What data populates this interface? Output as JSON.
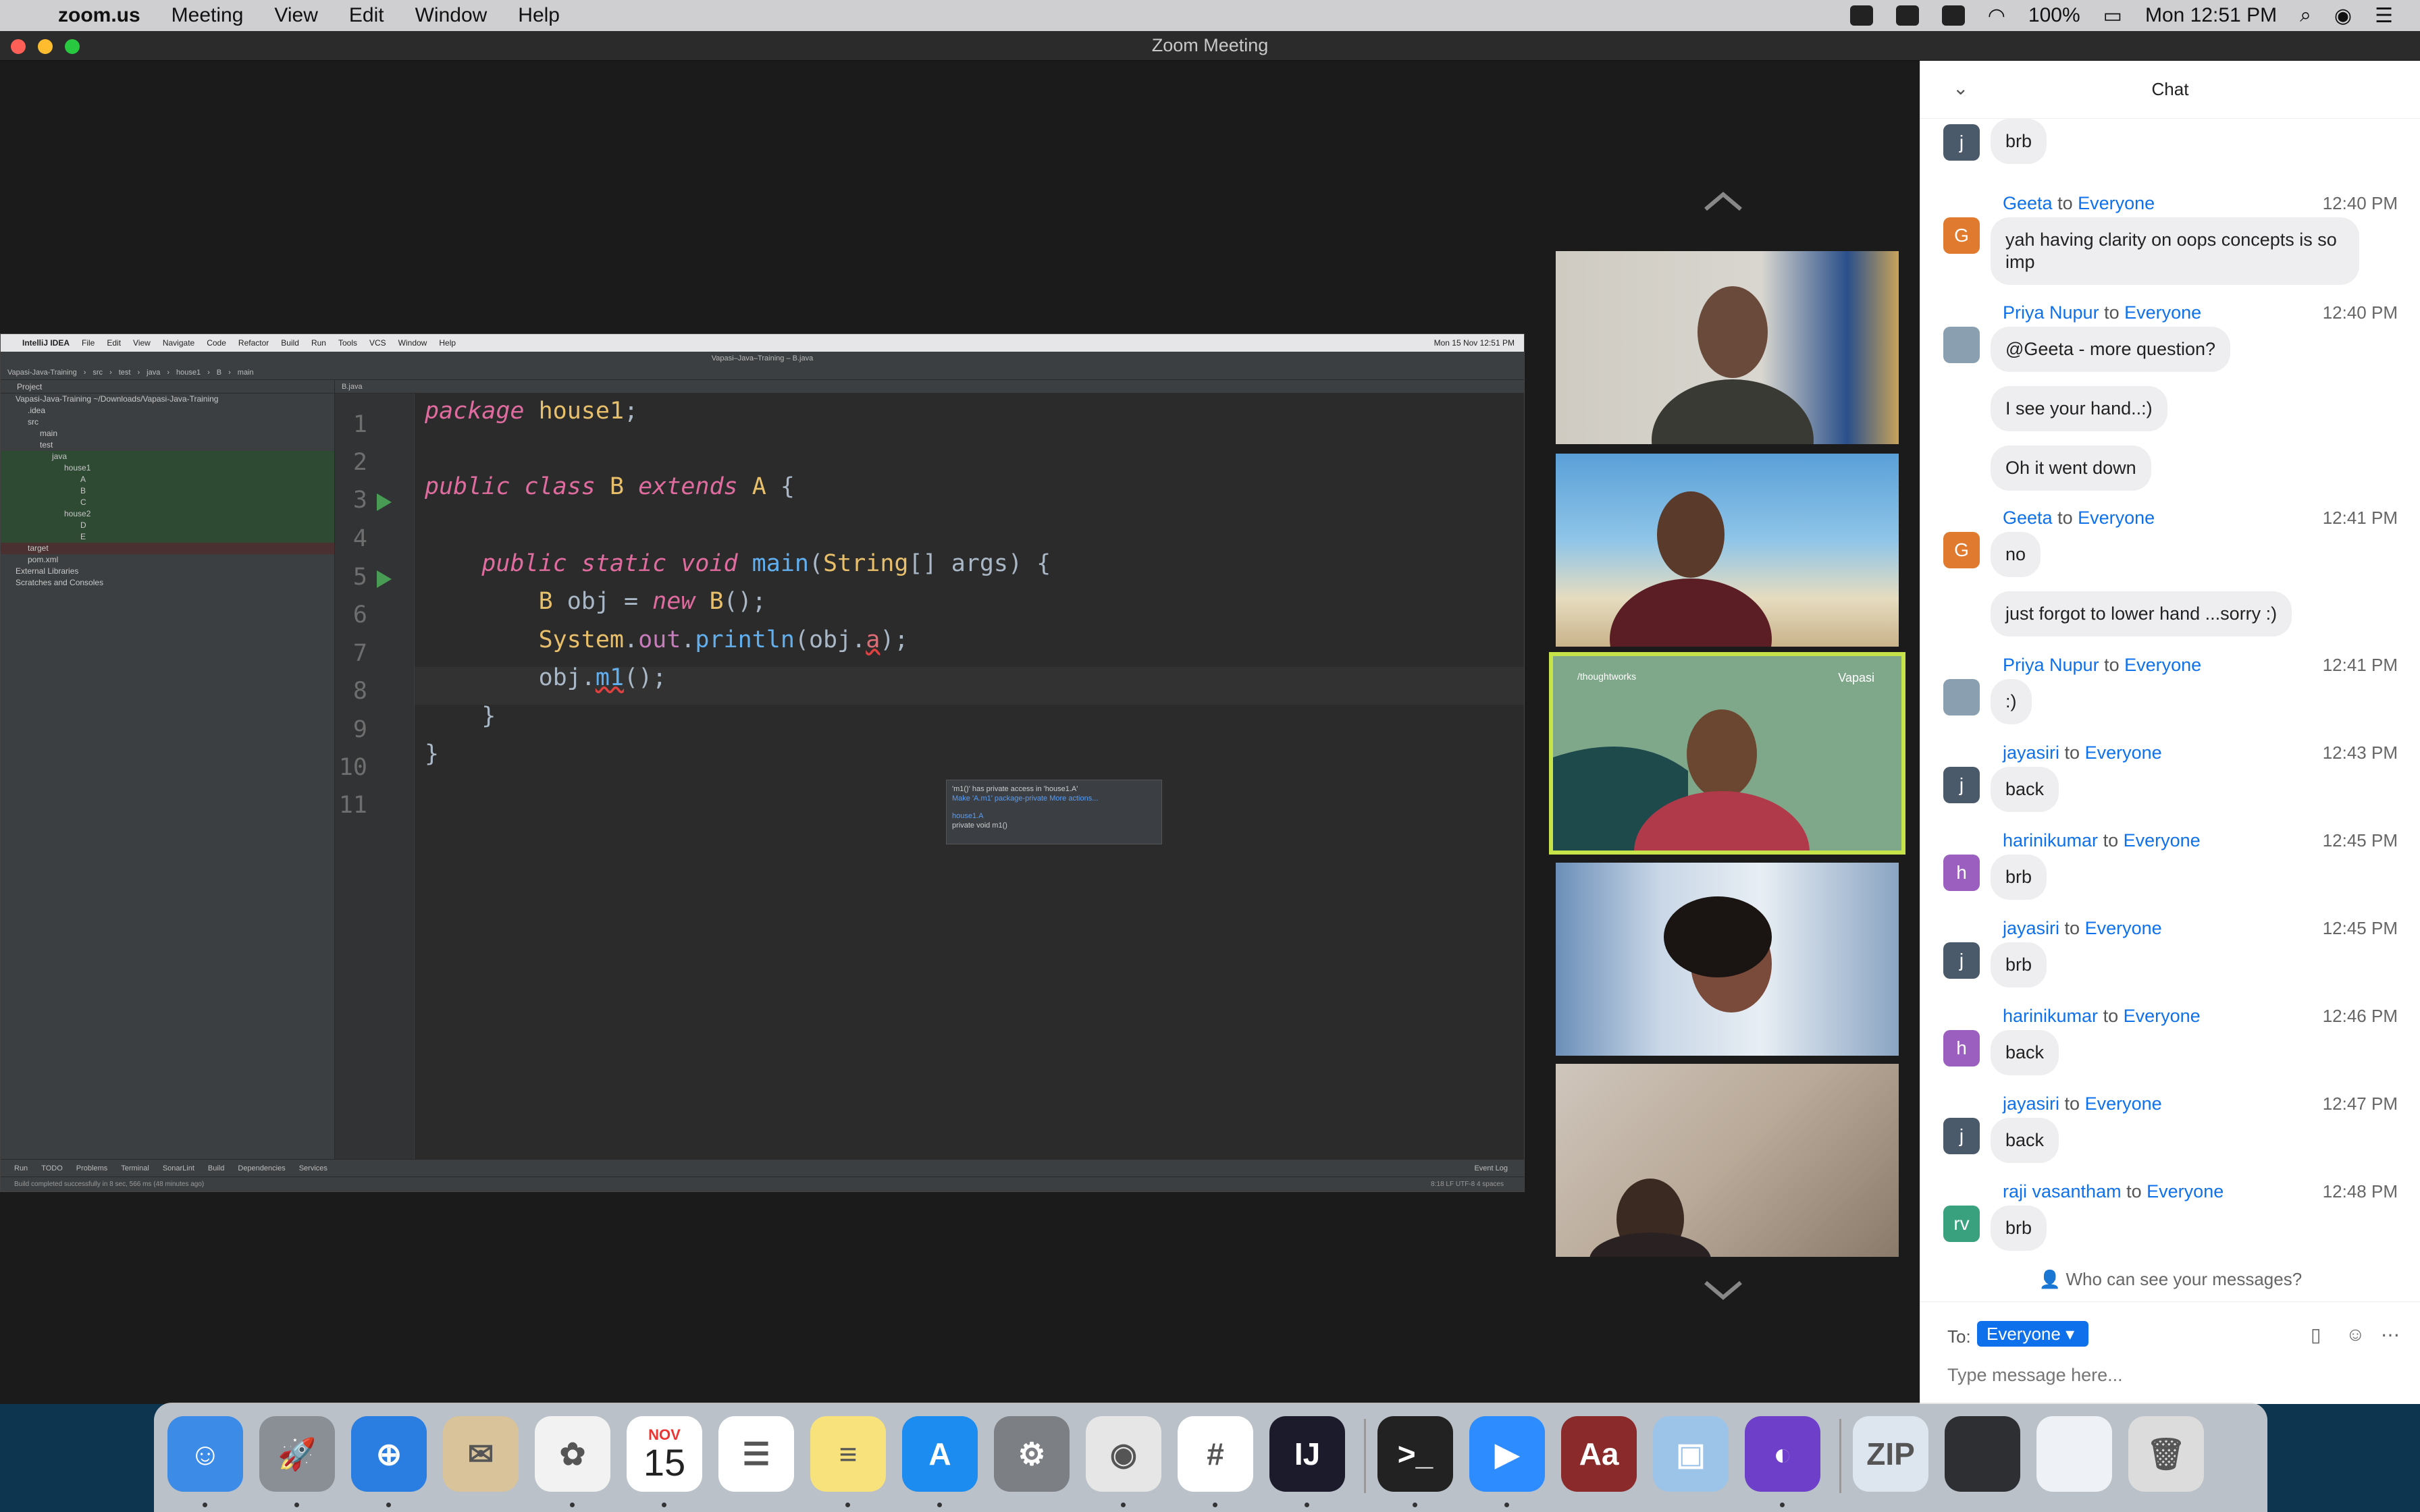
{
  "menubar": {
    "app": "zoom.us",
    "items": [
      "Meeting",
      "View",
      "Edit",
      "Window",
      "Help"
    ],
    "battery": "100%",
    "clock": "Mon 12:51 PM"
  },
  "window": {
    "title": "Zoom Meeting"
  },
  "shared_screen": {
    "ide_menu": [
      "IntelliJ IDEA",
      "File",
      "Edit",
      "View",
      "Navigate",
      "Code",
      "Refactor",
      "Build",
      "Run",
      "Tools",
      "VCS",
      "Window",
      "Help"
    ],
    "ide_clock": "Mon 15 Nov 12:51 PM",
    "ide_title": "Vapasi–Java–Training – B.java",
    "nav_crumbs": [
      "Vapasi-Java-Training",
      "src",
      "test",
      "java",
      "house1",
      "B",
      "main"
    ],
    "project_header": "Project",
    "project_tree": [
      "Vapasi-Java-Training ~/Downloads/Vapasi-Java-Training",
      ".idea",
      "src",
      "main",
      "test",
      "java",
      "house1",
      "A",
      "B",
      "C",
      "house2",
      "D",
      "E",
      "target",
      "pom.xml",
      "External Libraries",
      "Scratches and Consoles"
    ],
    "editor_tab": "B.java",
    "line_numbers": [
      "1",
      "2",
      "3",
      "4",
      "5",
      "6",
      "7",
      "8",
      "9",
      "10",
      "11"
    ],
    "popup": {
      "message": "'m1()' has private access in 'house1.A'",
      "fix": "Make 'A.m1' package-private",
      "more": "More actions...",
      "decl_pkg": "house1.A",
      "decl_sig": "private void m1()"
    },
    "bottom_tabs": [
      "Run",
      "TODO",
      "Problems",
      "Terminal",
      "SonarLint",
      "Build",
      "Dependencies",
      "Services",
      "Event Log"
    ],
    "status_text": "Build completed successfully in 8 sec, 566 ms (48 minutes ago)",
    "status_right": "8:18  LF  UTF-8  4 spaces"
  },
  "chat": {
    "title": "Chat",
    "to_label": "To:",
    "recipient": "Everyone",
    "placeholder": "Type message here...",
    "who_can_see": "Who can see your messages?",
    "to_word": "to",
    "messages": [
      {
        "avatar": "j",
        "color": "#4a5a6a",
        "sender": "",
        "time": "",
        "text": "brb"
      },
      {
        "avatar": "G",
        "color": "#e07a2e",
        "sender": "Geeta",
        "to": "Everyone",
        "time": "12:40 PM",
        "text": "yah having clarity on oops concepts is so imp"
      },
      {
        "avatar": "",
        "color": "#8aa0b0",
        "sender": "Priya Nupur",
        "to": "Everyone",
        "time": "12:40 PM",
        "text": "@Geeta - more question?"
      },
      {
        "text": "I see your hand..:)"
      },
      {
        "text": "Oh it went down"
      },
      {
        "avatar": "G",
        "color": "#e07a2e",
        "sender": "Geeta",
        "to": "Everyone",
        "time": "12:41 PM",
        "text": "no"
      },
      {
        "text": "just forgot to lower hand ...sorry :)"
      },
      {
        "avatar": "",
        "color": "#8aa0b0",
        "sender": "Priya Nupur",
        "to": "Everyone",
        "time": "12:41 PM",
        "text": ":)"
      },
      {
        "avatar": "j",
        "color": "#4a5a6a",
        "sender": "jayasiri",
        "to": "Everyone",
        "time": "12:43 PM",
        "text": "back"
      },
      {
        "avatar": "h",
        "color": "#9b5fc0",
        "sender": "harinikumar",
        "to": "Everyone",
        "time": "12:45 PM",
        "text": "brb"
      },
      {
        "avatar": "j",
        "color": "#4a5a6a",
        "sender": "jayasiri",
        "to": "Everyone",
        "time": "12:45 PM",
        "text": "brb"
      },
      {
        "avatar": "h",
        "color": "#9b5fc0",
        "sender": "harinikumar",
        "to": "Everyone",
        "time": "12:46 PM",
        "text": "back"
      },
      {
        "avatar": "j",
        "color": "#4a5a6a",
        "sender": "jayasiri",
        "to": "Everyone",
        "time": "12:47 PM",
        "text": "back"
      },
      {
        "avatar": "rv",
        "color": "#3aa17e",
        "sender": "raji vasantham",
        "to": "Everyone",
        "time": "12:48 PM",
        "text": "brb"
      }
    ]
  },
  "video_tile_logos": {
    "left": "/thoughtworks",
    "right": "Vapasi"
  },
  "calendar": {
    "month": "NOV",
    "day": "15"
  },
  "dock": [
    {
      "name": "finder",
      "color": "#3c8ce7",
      "glyph": "☺"
    },
    {
      "name": "launchpad",
      "color": "#8a8f96",
      "glyph": "🚀"
    },
    {
      "name": "safari",
      "color": "#2a7de1",
      "glyph": "⊕"
    },
    {
      "name": "mail",
      "color": "#d9c39a",
      "glyph": "✉"
    },
    {
      "name": "photos",
      "color": "#f2f2f2",
      "glyph": "✿"
    },
    {
      "name": "calendar",
      "color": "#ffffff",
      "glyph": ""
    },
    {
      "name": "reminders",
      "color": "#ffffff",
      "glyph": "☰"
    },
    {
      "name": "notes",
      "color": "#f7e27c",
      "glyph": "≡"
    },
    {
      "name": "app-store",
      "color": "#1c8cf0",
      "glyph": "A"
    },
    {
      "name": "system-preferences",
      "color": "#7c7f84",
      "glyph": "⚙"
    },
    {
      "name": "chrome",
      "color": "#e6e6e6",
      "glyph": "◉"
    },
    {
      "name": "slack",
      "color": "#ffffff",
      "glyph": "#"
    },
    {
      "name": "intellij",
      "color": "#1b1b2b",
      "glyph": "IJ"
    },
    {
      "name": "terminal",
      "color": "#222222",
      "glyph": ">_"
    },
    {
      "name": "zoom",
      "color": "#2d8cff",
      "glyph": "▶"
    },
    {
      "name": "dictionary",
      "color": "#8b2a2a",
      "glyph": "Aa"
    },
    {
      "name": "preview",
      "color": "#9cc3e8",
      "glyph": "▣"
    },
    {
      "name": "github-desktop",
      "color": "#6e40c9",
      "glyph": "◐"
    },
    {
      "name": "zip-archive",
      "color": "#dde5ee",
      "glyph": "ZIP"
    },
    {
      "name": "recent-window-1",
      "color": "#2d2f33",
      "glyph": ""
    },
    {
      "name": "recent-window-2",
      "color": "#eef2f6",
      "glyph": ""
    },
    {
      "name": "trash",
      "color": "#dcdcdc",
      "glyph": "🗑"
    }
  ]
}
